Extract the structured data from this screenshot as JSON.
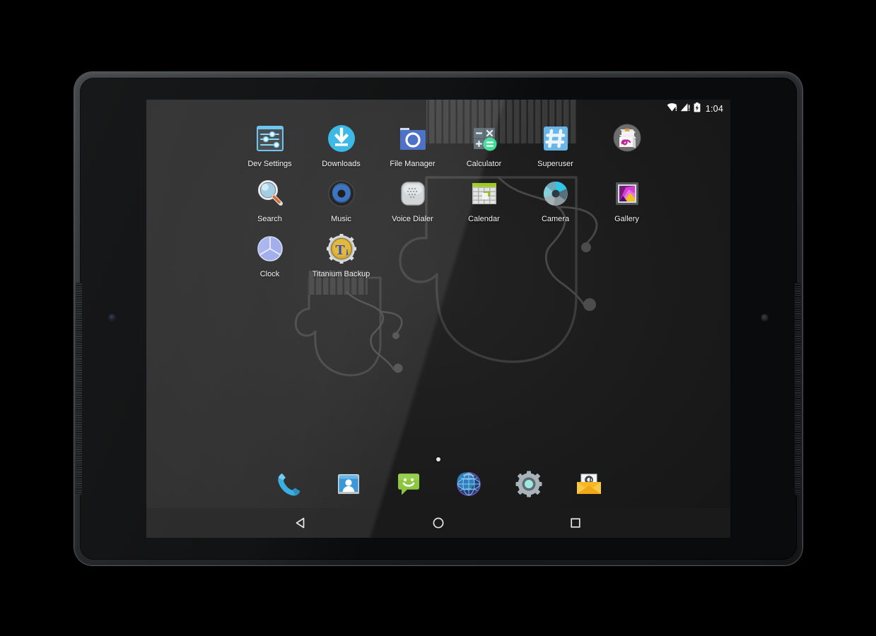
{
  "device": {
    "type": "android-tablet",
    "orientation": "landscape"
  },
  "status_bar": {
    "time": "1:04",
    "icons": [
      "wifi-icon",
      "signal-icon",
      "battery-charging-icon"
    ],
    "wifi_label": "wifi-icon",
    "signal_label": "signal-icon",
    "battery_label": "battery-charging-icon"
  },
  "home_screen": {
    "page_indicator": {
      "total": 1,
      "current": 1
    },
    "rows": [
      [
        {
          "name": "dev-settings",
          "label": "Dev Settings",
          "icon": "sliders-icon",
          "accent": "#4ab3e8"
        },
        {
          "name": "downloads",
          "label": "Downloads",
          "icon": "download-circle-icon",
          "accent": "#2bb3e3"
        },
        {
          "name": "file-manager",
          "label": "File Manager",
          "icon": "folder-icon",
          "accent": "#3f66c4"
        },
        {
          "name": "calculator",
          "label": "Calculator",
          "icon": "calculator-icon",
          "accent": "#3ddc97"
        },
        {
          "name": "superuser",
          "label": "Superuser",
          "icon": "hash-icon",
          "accent": "#6ab6e8"
        },
        {
          "name": "notes-sketch",
          "label": "",
          "icon": "note-pen-icon",
          "accent": "#c2249a"
        }
      ],
      [
        {
          "name": "search",
          "label": "Search",
          "icon": "magnifier-icon",
          "accent": "#a8d8f0"
        },
        {
          "name": "music",
          "label": "Music",
          "icon": "speaker-icon",
          "accent": "#2a5ea8"
        },
        {
          "name": "voice-dialer",
          "label": "Voice Dialer",
          "icon": "microphone-grid-icon",
          "accent": "#cfd2d4"
        },
        {
          "name": "calendar",
          "label": "Calendar",
          "icon": "calendar-grid-icon",
          "accent": "#9ecb1e"
        },
        {
          "name": "camera",
          "label": "Camera",
          "icon": "aperture-icon",
          "accent": "#2ec8e6"
        },
        {
          "name": "gallery",
          "label": "Gallery",
          "icon": "photo-frame-icon",
          "accent": "#d84fd8"
        }
      ],
      [
        {
          "name": "clock",
          "label": "Clock",
          "icon": "clock-icon",
          "accent": "#9aa8e8"
        },
        {
          "name": "titanium-backup",
          "label": "Titanium Backup",
          "icon": "gear-ti-icon",
          "accent": "#d9a81e"
        }
      ]
    ]
  },
  "dock": {
    "items": [
      {
        "name": "phone",
        "label": "Phone",
        "icon": "phone-handset-icon",
        "accent": "#2aa8e0"
      },
      {
        "name": "contacts",
        "label": "Contacts",
        "icon": "contacts-card-icon",
        "accent": "#2b8fd4"
      },
      {
        "name": "messaging",
        "label": "Messaging",
        "icon": "speech-bubble-smile-icon",
        "accent": "#8cc63f"
      },
      {
        "name": "browser",
        "label": "Browser",
        "icon": "globe-icon",
        "accent": "#2f7fc0"
      },
      {
        "name": "settings",
        "label": "Settings",
        "icon": "gear-icon",
        "accent": "#a9b4ba"
      },
      {
        "name": "email",
        "label": "Email",
        "icon": "envelope-at-icon",
        "accent": "#f5b820"
      }
    ]
  },
  "nav_bar": {
    "buttons": [
      {
        "name": "back-button",
        "label": "Back",
        "icon": "triangle-left-icon"
      },
      {
        "name": "home-button",
        "label": "Home",
        "icon": "circle-icon"
      },
      {
        "name": "recents-button",
        "label": "Recent apps",
        "icon": "square-icon"
      }
    ]
  },
  "wallpaper": {
    "name": "mittens-wallpaper",
    "description": "Two outlined mittens with ribbed cuffs and connecting string"
  }
}
